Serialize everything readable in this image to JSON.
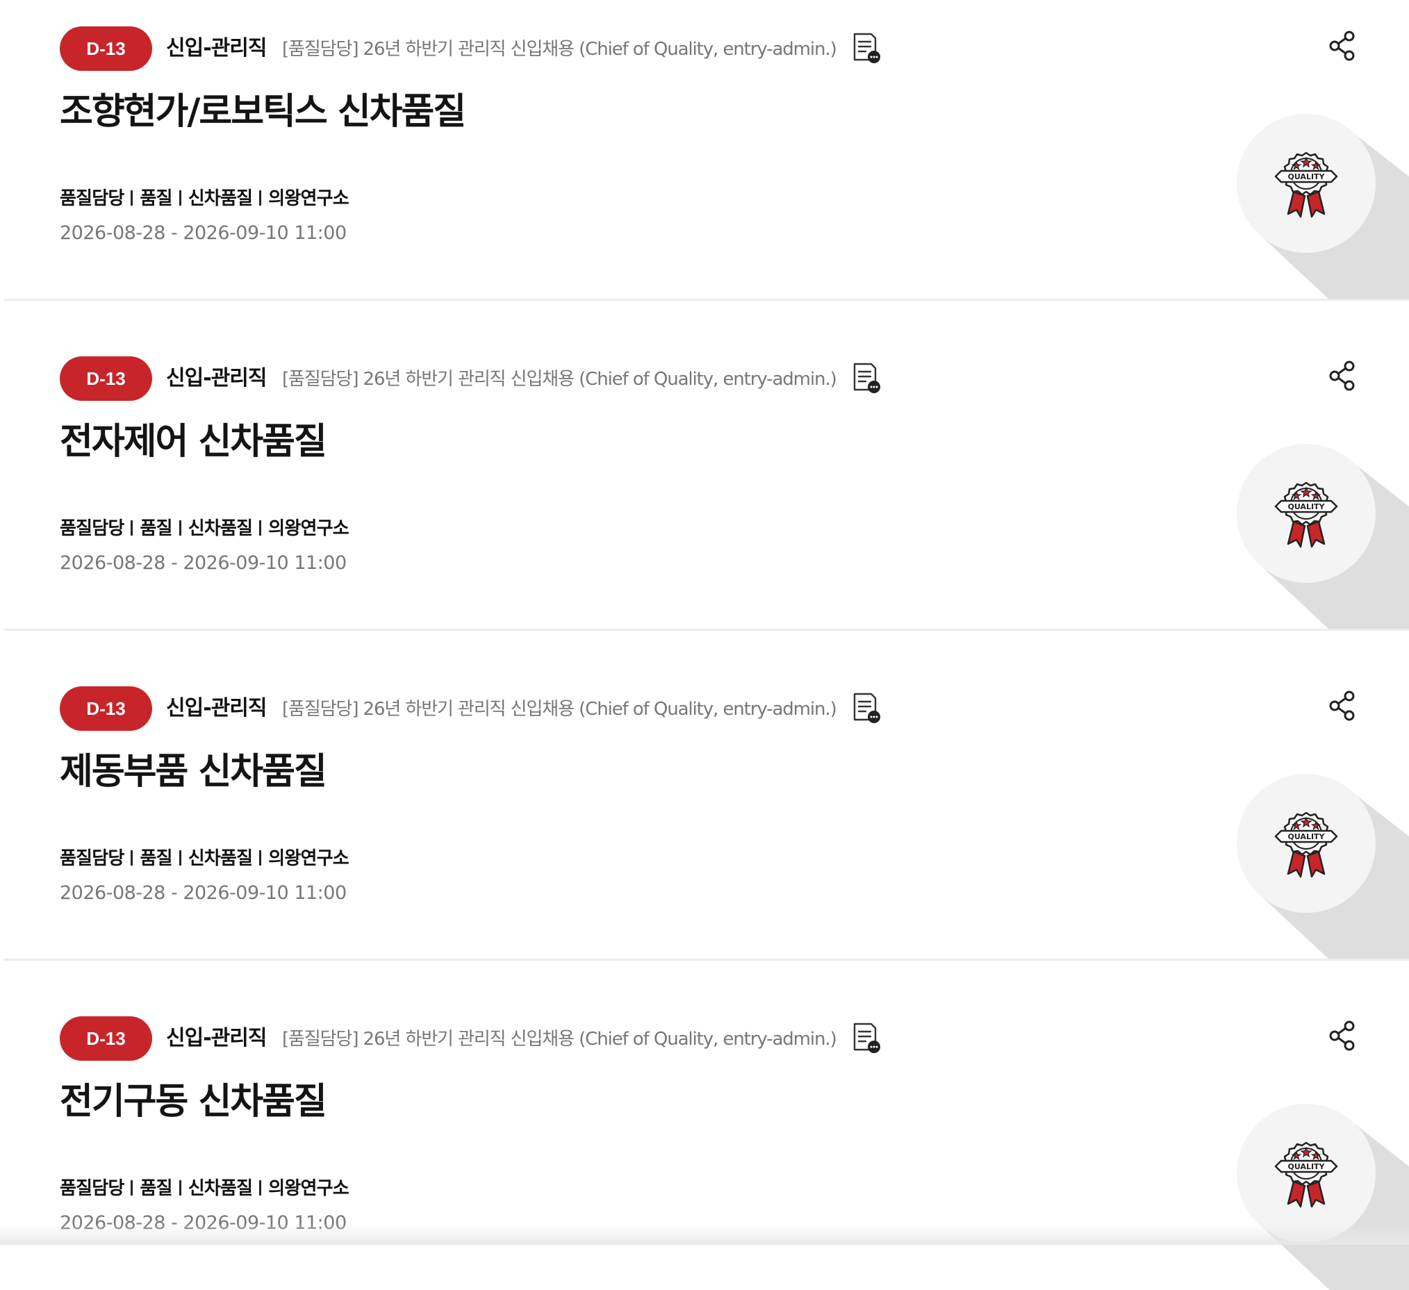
{
  "colors": {
    "accent": "#c8252b",
    "muted_text": "#777777",
    "emblem_bg": "#f4f4f4",
    "emblem_shadow": "#dedede"
  },
  "postings": [
    {
      "dday": "D-13",
      "category": "신입-관리직",
      "notice": "[품질담당] 26년 하반기 관리직 신입채용 (Chief of Quality, entry-admin.)",
      "title": "조향현가/로보틱스 신차품질",
      "tags": [
        "품질담당",
        "품질",
        "신차품질",
        "의왕연구소"
      ],
      "period": "2026-08-28 - 2026-09-10 11:00",
      "emblem_text": "QUALITY",
      "notice_icon": "document-icon",
      "share_icon": "share-icon"
    },
    {
      "dday": "D-13",
      "category": "신입-관리직",
      "notice": "[품질담당] 26년 하반기 관리직 신입채용 (Chief of Quality, entry-admin.)",
      "title": "전자제어 신차품질",
      "tags": [
        "품질담당",
        "품질",
        "신차품질",
        "의왕연구소"
      ],
      "period": "2026-08-28 - 2026-09-10 11:00",
      "emblem_text": "QUALITY",
      "notice_icon": "document-icon",
      "share_icon": "share-icon"
    },
    {
      "dday": "D-13",
      "category": "신입-관리직",
      "notice": "[품질담당] 26년 하반기 관리직 신입채용 (Chief of Quality, entry-admin.)",
      "title": "제동부품 신차품질",
      "tags": [
        "품질담당",
        "품질",
        "신차품질",
        "의왕연구소"
      ],
      "period": "2026-08-28 - 2026-09-10 11:00",
      "emblem_text": "QUALITY",
      "notice_icon": "document-icon",
      "share_icon": "share-icon"
    },
    {
      "dday": "D-13",
      "category": "신입-관리직",
      "notice": "[품질담당] 26년 하반기 관리직 신입채용 (Chief of Quality, entry-admin.)",
      "title": "전기구동 신차품질",
      "tags": [
        "품질담당",
        "품질",
        "신차품질",
        "의왕연구소"
      ],
      "period": "2026-08-28 - 2026-09-10 11:00",
      "emblem_text": "QUALITY",
      "notice_icon": "document-icon",
      "share_icon": "share-icon"
    }
  ]
}
